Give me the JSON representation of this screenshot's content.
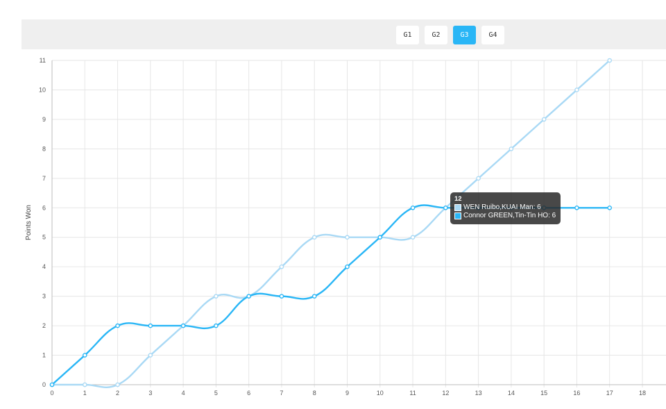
{
  "game_tabs": [
    {
      "label": "G1",
      "active": false
    },
    {
      "label": "G2",
      "active": false
    },
    {
      "label": "G3",
      "active": true
    },
    {
      "label": "G4",
      "active": false
    }
  ],
  "chart_data": {
    "type": "line",
    "ylabel": "Points Won",
    "xlim": [
      0,
      18
    ],
    "ylim": [
      0,
      11
    ],
    "xticks": [
      0,
      1,
      2,
      3,
      4,
      5,
      6,
      7,
      8,
      9,
      10,
      11,
      12,
      13,
      14,
      15,
      16,
      17,
      18
    ],
    "yticks": [
      0,
      1,
      2,
      3,
      4,
      5,
      6,
      7,
      8,
      9,
      10,
      11
    ],
    "grid": true,
    "series": [
      {
        "name": "WEN Ruibo,KUAI Man",
        "color": "#a9d9f5",
        "x": [
          0,
          1,
          2,
          3,
          4,
          5,
          6,
          7,
          8,
          9,
          10,
          11,
          12,
          13,
          14,
          15,
          16,
          17
        ],
        "values": [
          0,
          0,
          0,
          1,
          2,
          3,
          3,
          4,
          5,
          5,
          5,
          5,
          6,
          7,
          8,
          9,
          10,
          11
        ]
      },
      {
        "name": "Connor GREEN,Tin-Tin HO",
        "color": "#29b6f6",
        "x": [
          0,
          1,
          2,
          3,
          4,
          5,
          6,
          7,
          8,
          9,
          10,
          11,
          12,
          13,
          14,
          15,
          16,
          17
        ],
        "values": [
          0,
          1,
          2,
          2,
          2,
          2,
          3,
          3,
          3,
          4,
          5,
          6,
          6,
          6,
          6,
          6,
          6,
          6
        ]
      }
    ],
    "tooltip": {
      "title": "12",
      "rows": [
        {
          "label": "WEN Ruibo,KUAI Man: 6",
          "color": "#a9d9f5"
        },
        {
          "label": "Connor GREEN,Tin-Tin HO: 6",
          "color": "#29b6f6"
        }
      ]
    }
  }
}
